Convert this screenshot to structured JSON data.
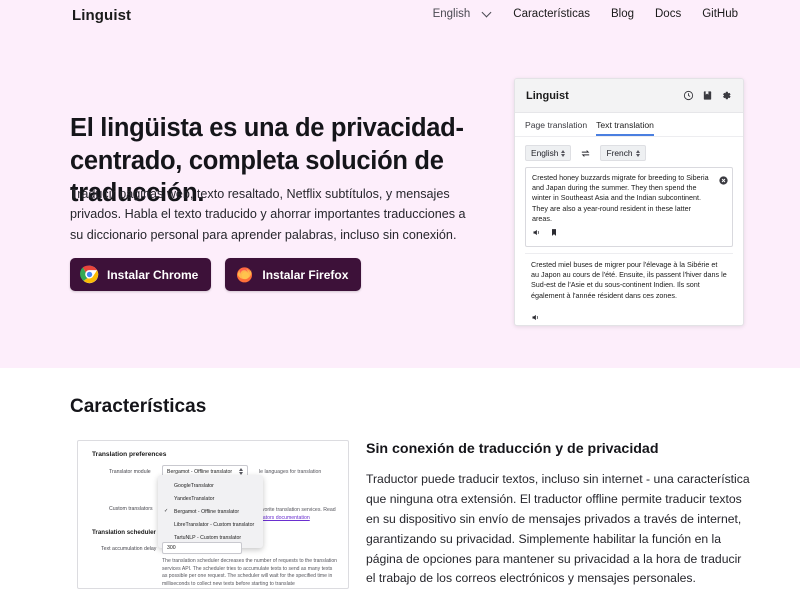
{
  "nav": {
    "brand": "Linguist",
    "language_value": "English",
    "links": [
      {
        "label": "Características"
      },
      {
        "label": "Blog"
      },
      {
        "label": "Docs"
      },
      {
        "label": "GitHub"
      }
    ]
  },
  "hero": {
    "title": "El lingüista es una de privacidad-centrado, completa solución de traducción.",
    "subtitle": "Traducir páginas web, texto resaltado, Netflix subtítulos, y mensajes privados. Habla el texto traducido y ahorrar importantes traducciones a su diccionario personal para aprender palabras, incluso sin conexión.",
    "install_chrome": "Instalar Chrome",
    "install_firefox": "Instalar Firefox",
    "button_color": "#3d1139",
    "background_color": "#fdeefb"
  },
  "widget": {
    "title": "Linguist",
    "header_icons": [
      "history-icon",
      "save-icon",
      "gear-icon"
    ],
    "tabs": [
      {
        "label": "Page translation",
        "active": false
      },
      {
        "label": "Text translation",
        "active": true
      }
    ],
    "active_tab_color": "#4a7fe0",
    "source_language": "English",
    "target_language": "French",
    "swap_icon": "swap-arrows-icon",
    "source_text": "Crested honey buzzards migrate for breeding to Siberia and Japan during the summer. They then spend the winter in Southeast Asia and the Indian subcontinent. They are also a year-round resident in these latter areas.",
    "translated_text": "Crested miel buses de migrer pour l'élevage à la Sibérie et au Japon au cours de l'été. Ensuite, ils passent l'hiver dans le Sud-est de l'Asie et du sous-continent Indien. Ils sont également à l'année résident dans ces zones."
  },
  "features": {
    "section_title": "Características",
    "heading": "Sin conexión de traducción y de privacidad",
    "body": "Traductor puede traducir textos, incluso sin internet - una característica que ninguna otra extensión. El traductor offline permite traducir textos en su dispositivo sin envío de mensajes privados a través de internet, garantizando su privacidad. Simplemente habilitar la función en la página de opciones para mantener su privacidad a la hora de traducir el trabajo de los correos electrónicos y mensajes personales."
  },
  "screenshot": {
    "panel_title": "Translation preferences",
    "translator_module_label": "Translator module",
    "translator_module_value": "Bergamot - Offline translator",
    "custom_translators_label": "Custom translators",
    "note_right_1": "le languages for translation",
    "note_right_2": "avorite translation services. Read",
    "note_right_link": "slators documentation",
    "dropdown_options": [
      {
        "label": "GoogleTranslator",
        "checked": false
      },
      {
        "label": "YandexTranslator",
        "checked": false
      },
      {
        "label": "Bergamot - Offline translator",
        "checked": true
      },
      {
        "label": "LibreTranslator - Custom translator",
        "checked": false
      },
      {
        "label": "TartuNLP - Custom translator",
        "checked": false
      }
    ],
    "scheduler_title": "Translation scheduler",
    "delay_label": "Text accumulation delay",
    "delay_value": "300",
    "scheduler_desc": "The translation scheduler decreases the number of requests to the translation services API. The scheduler tries to accumulate texts to send as many texts as possible per one request. The scheduler will wait for the specified time in milliseconds to collect new texts before starting to translate"
  }
}
